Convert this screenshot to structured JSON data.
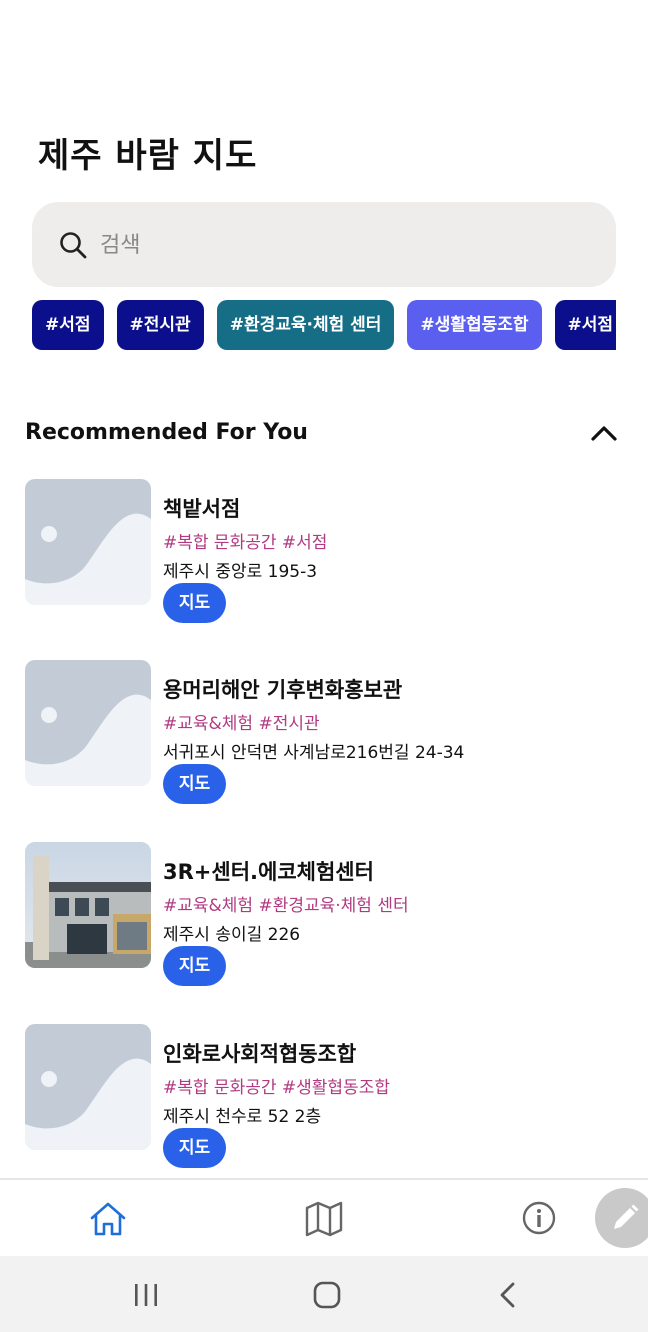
{
  "app": {
    "title": "제주 바람 지도"
  },
  "search": {
    "placeholder": "검색"
  },
  "chips": [
    {
      "label": "#서점",
      "color": "#0c0f8c"
    },
    {
      "label": "#전시관",
      "color": "#0c0f8c"
    },
    {
      "label": "#환경교육·체험 센터",
      "color": "#156e85"
    },
    {
      "label": "#생활협동조합",
      "color": "#5a5ff0"
    },
    {
      "label": "#서점",
      "color": "#0c0f8c"
    }
  ],
  "recommended": {
    "title": "Recommended For You",
    "collapse_icon": "chevron-up-icon",
    "items": [
      {
        "name": "책밭서점",
        "tags": "#복합 문화공간 #서점",
        "address": "제주시  중앙로 195-3",
        "map_label": "지도",
        "image": "placeholder"
      },
      {
        "name": "용머리해안 기후변화홍보관",
        "tags": "#교육&체험 #전시관",
        "address": "서귀포시 안덕면 사계남로216번길 24-34",
        "map_label": "지도",
        "image": "placeholder"
      },
      {
        "name": "3R+센터.에코체험센터",
        "tags": "#교육&체험 #환경교육·체험 센터",
        "address": "제주시 송이길 226",
        "map_label": "지도",
        "image": "building-photo"
      },
      {
        "name": "인화로사회적협동조합",
        "tags": "#복합 문화공간 #생활협동조합",
        "address": "제주시 천수로 52 2층",
        "map_label": "지도",
        "image": "placeholder"
      }
    ]
  },
  "bottom_nav": {
    "items": [
      {
        "icon": "home-icon",
        "active": true
      },
      {
        "icon": "map-icon",
        "active": false
      },
      {
        "icon": "info-icon",
        "active": false
      }
    ],
    "fab_icon": "pencil-icon"
  },
  "colors": {
    "accent": "#2962e9",
    "tag_text": "#b23a82",
    "active_nav": "#1e6ed8"
  }
}
